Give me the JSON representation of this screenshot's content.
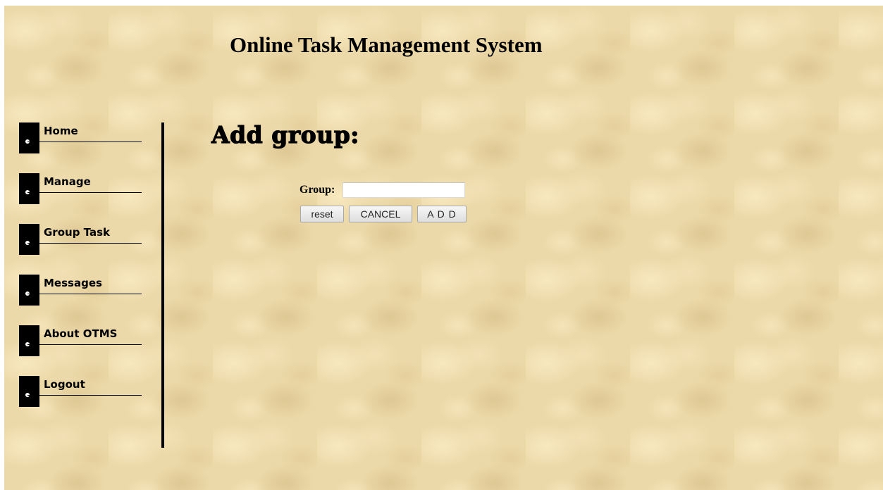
{
  "header": {
    "title": "Online Task Management System"
  },
  "sidebar": {
    "items": [
      {
        "label": "Home"
      },
      {
        "label": "Manage"
      },
      {
        "label": "Group Task"
      },
      {
        "label": "Messages"
      },
      {
        "label": "About OTMS"
      },
      {
        "label": "Logout"
      }
    ]
  },
  "main": {
    "heading": "Add group:",
    "form": {
      "group_label": "Group:",
      "group_value": "",
      "group_placeholder": "",
      "reset_label": "reset",
      "cancel_label": "CANCEL",
      "add_label": "A D D"
    }
  },
  "colors": {
    "background": "#ecd9a9",
    "text": "#000000",
    "nav_marker": "#000000"
  }
}
